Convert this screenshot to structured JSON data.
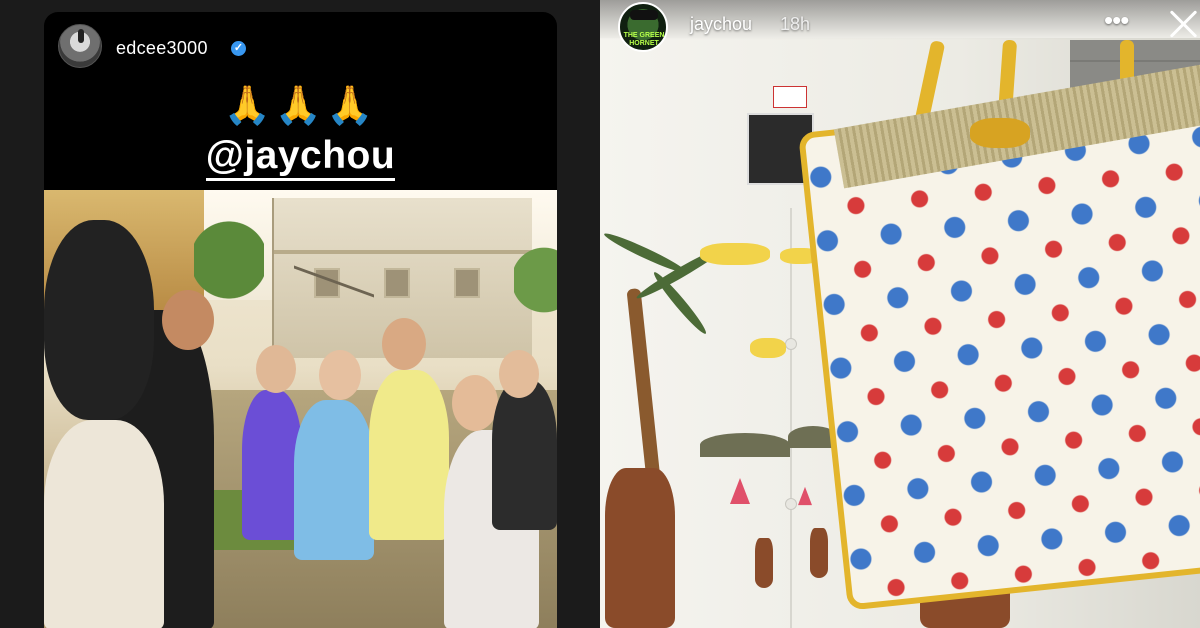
{
  "left_story": {
    "username": "edcee3000",
    "verified_badge": "✓",
    "emoji_row": "🙏🙏🙏",
    "mention": "@jaychou"
  },
  "right_story": {
    "username": "jaychou",
    "time_ago": "18h",
    "more_label": "•••",
    "avatar_text": "THE GREEN HORNET"
  },
  "icons": {
    "verified": "verified-badge-icon",
    "more": "more-options-icon",
    "close": "close-icon"
  },
  "colors": {
    "verified_blue": "#3897f0",
    "bag_trim_yellow": "#e3b52c"
  }
}
